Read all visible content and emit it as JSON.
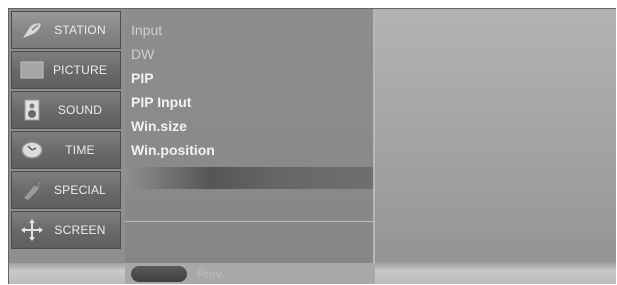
{
  "menu": {
    "items": [
      {
        "label": "STATION",
        "icon": "satellite-dish-icon",
        "selected": true
      },
      {
        "label": "PICTURE",
        "icon": "picture-icon",
        "selected": false
      },
      {
        "label": "SOUND",
        "icon": "speaker-icon",
        "selected": false
      },
      {
        "label": "TIME",
        "icon": "clock-icon",
        "selected": false
      },
      {
        "label": "SPECIAL",
        "icon": "special-tag-icon",
        "selected": false
      },
      {
        "label": "SCREEN",
        "icon": "move-arrows-icon",
        "selected": false
      }
    ]
  },
  "submenu": {
    "items": [
      {
        "label": "Input",
        "dim": true
      },
      {
        "label": "DW",
        "dim": true
      },
      {
        "label": "PIP",
        "dim": false
      },
      {
        "label": "PIP Input",
        "dim": false
      },
      {
        "label": "Win.size",
        "dim": false
      },
      {
        "label": "Win.position",
        "dim": false
      }
    ]
  },
  "footer": {
    "label": "Prev."
  }
}
